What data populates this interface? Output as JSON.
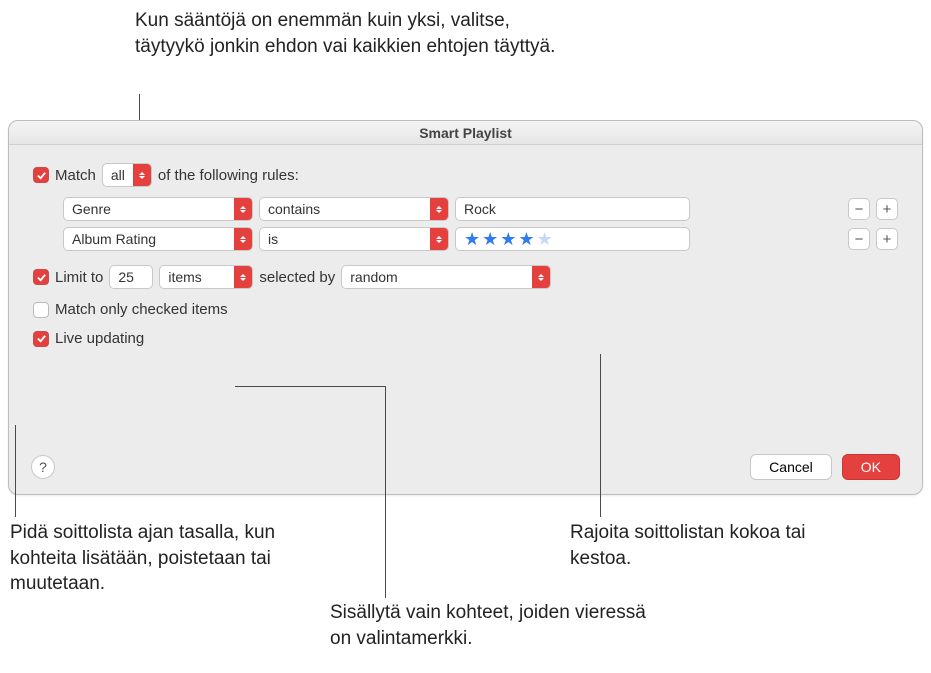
{
  "annotations": {
    "top": "Kun sääntöjä on enemmän kuin yksi, valitse, täytyykö jonkin ehdon vai kaikkien ehtojen täyttyä.",
    "bottom_left": "Pidä soittolista ajan tasalla, kun kohteita lisätään, poistetaan tai muutetaan.",
    "bottom_mid": "Sisällytä vain kohteet, joiden vieressä on valintamerkki.",
    "bottom_right": "Rajoita soittolistan kokoa tai kestoa."
  },
  "dialog": {
    "title": "Smart Playlist",
    "match": {
      "label_pre": "Match",
      "mode": "all",
      "label_post": "of the following rules:"
    },
    "rules": [
      {
        "attribute": "Genre",
        "operator": "contains",
        "value": "Rock",
        "value_type": "text"
      },
      {
        "attribute": "Album Rating",
        "operator": "is",
        "value": "4",
        "value_type": "stars"
      }
    ],
    "limit": {
      "label": "Limit to",
      "count": "25",
      "unit": "items",
      "selected_by_label": "selected by",
      "method": "random"
    },
    "match_checked": {
      "label": "Match only checked items",
      "checked": false
    },
    "live_updating": {
      "label": "Live updating",
      "checked": true
    },
    "buttons": {
      "cancel": "Cancel",
      "ok": "OK"
    }
  }
}
